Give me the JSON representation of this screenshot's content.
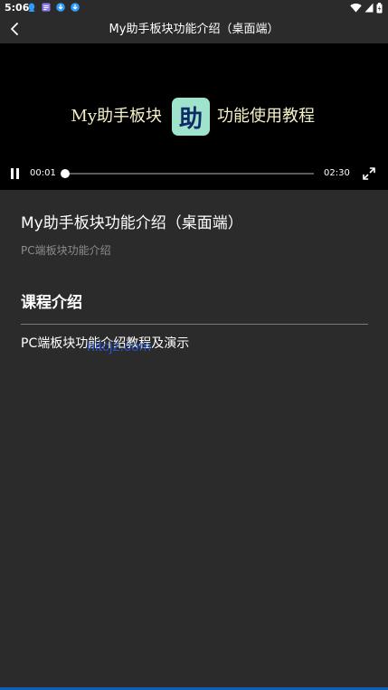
{
  "status_bar": {
    "time": "5:06",
    "notifications": [
      {
        "icon": "qq-icon",
        "color": "#2e9bff"
      },
      {
        "icon": "notepad-icon",
        "color": "#8a7cf0"
      },
      {
        "icon": "download-icon",
        "color": "#2e9bff"
      },
      {
        "icon": "download-icon",
        "color": "#2e9bff"
      }
    ],
    "system_icons": [
      "wifi-icon",
      "signal-icon",
      "battery-icon"
    ]
  },
  "app_bar": {
    "back_icon": "back-arrow-icon",
    "title": "My助手板块功能介绍（桌面端）"
  },
  "video": {
    "banner_left": "My助手板块",
    "banner_logo_text": "助",
    "banner_right": "功能使用教程",
    "current_time": "00:01",
    "total_time": "02:30",
    "progress": 0.007,
    "state": "playing",
    "colors": {
      "banner_text": "#f3f1c8",
      "logo_background": "#9fe3cd",
      "logo_glyph": "#102a66"
    }
  },
  "course": {
    "title": "My助手板块功能介绍（桌面端）",
    "subtitle": "PC端板块功能介绍"
  },
  "intro": {
    "heading": "课程介绍",
    "text": "PC端板块功能介绍教程及演示"
  },
  "watermark": "nitcjz.com",
  "colors": {
    "background": "#2b2b2b",
    "video_background": "#000000",
    "accent_bottom": "#0e5fb8"
  }
}
